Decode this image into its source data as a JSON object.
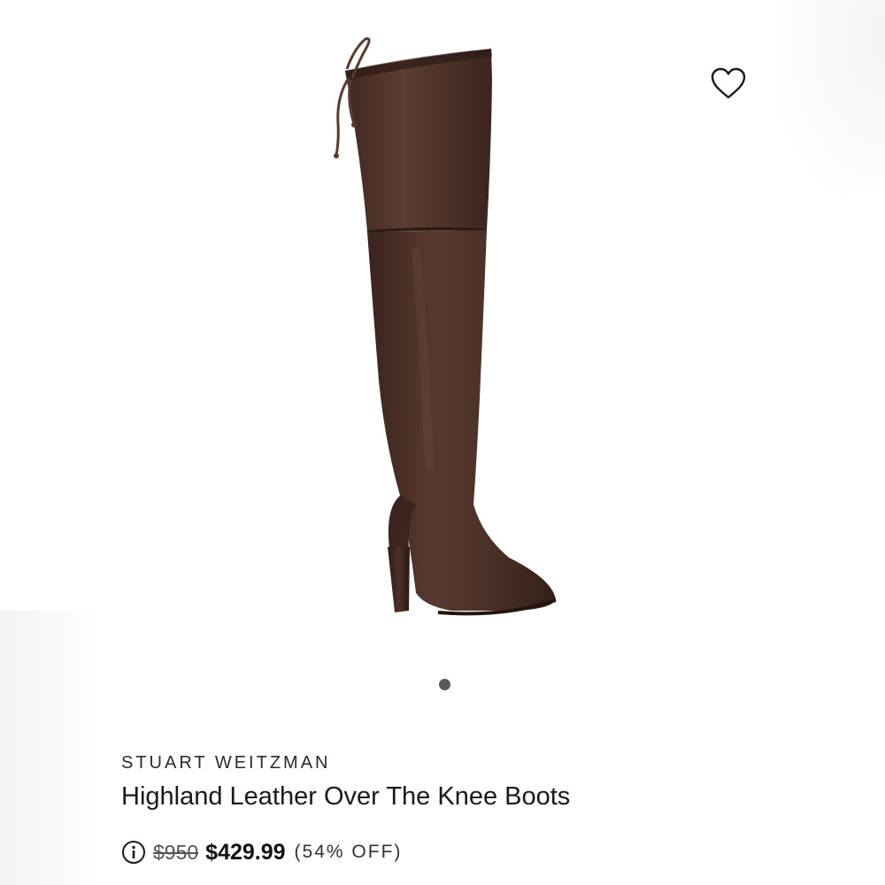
{
  "product": {
    "brand": "STUART WEITZMAN",
    "name": "Highland Leather Over The Knee Boots",
    "image_alt": "Brown over-the-knee leather boot with block heel and back tie",
    "image_color": "#4a3128"
  },
  "wishlist": {
    "icon": "heart-outline-icon"
  },
  "carousel": {
    "total": 1,
    "active": 1
  },
  "pricing": {
    "info_icon": "info-circle-icon",
    "original_price": "$950",
    "sale_price": "$429.99",
    "discount": "(54% OFF)"
  }
}
